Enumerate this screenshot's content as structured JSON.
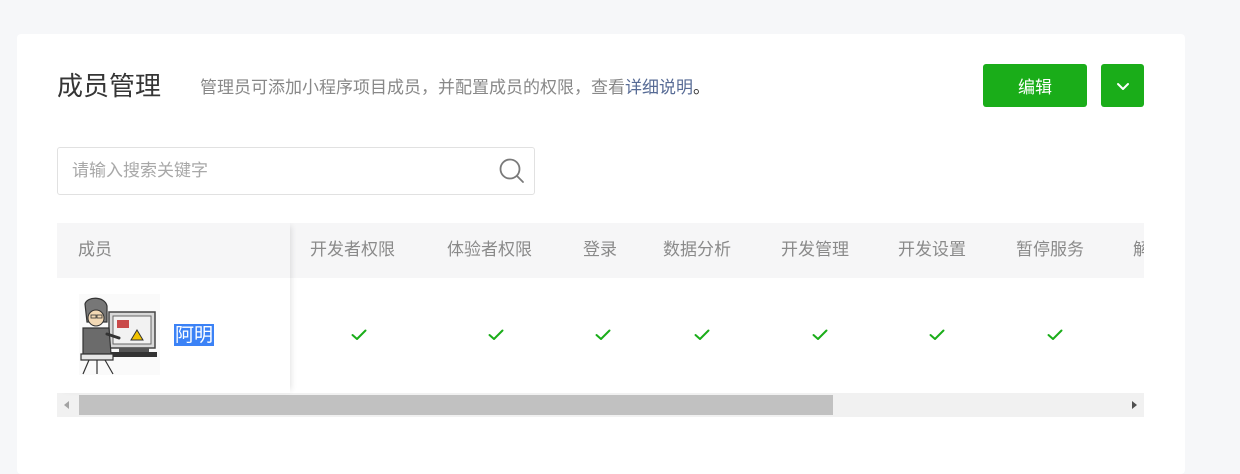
{
  "header": {
    "title": "成员管理",
    "description": "管理员可添加小程序项目成员，并配置成员的权限，查看",
    "link_text": "详细说明",
    "period": "。",
    "edit_label": "编辑"
  },
  "search": {
    "placeholder": "请输入搜索关键字",
    "value": ""
  },
  "table": {
    "columns": [
      "成员",
      "开发者权限",
      "体验者权限",
      "登录",
      "数据分析",
      "开发管理",
      "开发设置",
      "暂停服务",
      "解"
    ],
    "rows": [
      {
        "name": "阿明",
        "permissions": [
          true,
          true,
          true,
          true,
          true,
          true,
          true
        ]
      }
    ]
  },
  "colors": {
    "accent": "#1aad19",
    "link": "#576b95",
    "check": "#1aad19",
    "selection": "#3b82f6"
  },
  "icons": {
    "search": "search-icon",
    "dropdown": "chevron-down-icon",
    "check": "check-icon"
  }
}
